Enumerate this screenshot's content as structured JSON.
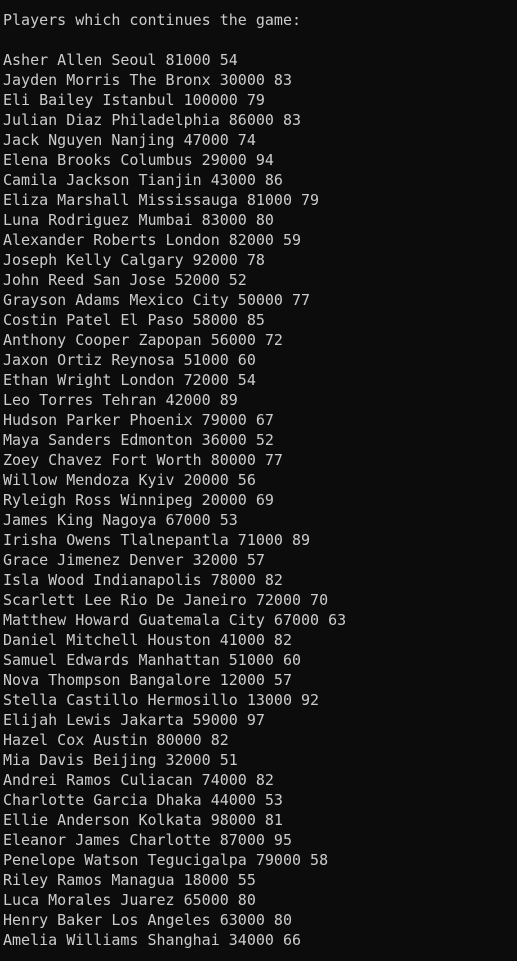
{
  "console": {
    "header": "Players which continues the game:",
    "players": [
      "Asher Allen Seoul 81000 54",
      "Jayden Morris The Bronx 30000 83",
      "Eli Bailey Istanbul 100000 79",
      "Julian Diaz Philadelphia 86000 83",
      "Jack Nguyen Nanjing 47000 74",
      "Elena Brooks Columbus 29000 94",
      "Camila Jackson Tianjin 43000 86",
      "Eliza Marshall Mississauga 81000 79",
      "Luna Rodriguez Mumbai 83000 80",
      "Alexander Roberts London 82000 59",
      "Joseph Kelly Calgary 92000 78",
      "John Reed San Jose 52000 52",
      "Grayson Adams Mexico City 50000 77",
      "Costin Patel El Paso 58000 85",
      "Anthony Cooper Zapopan 56000 72",
      "Jaxon Ortiz Reynosa 51000 60",
      "Ethan Wright London 72000 54",
      "Leo Torres Tehran 42000 89",
      "Hudson Parker Phoenix 79000 67",
      "Maya Sanders Edmonton 36000 52",
      "Zoey Chavez Fort Worth 80000 77",
      "Willow Mendoza Kyiv 20000 56",
      "Ryleigh Ross Winnipeg 20000 69",
      "James King Nagoya 67000 53",
      "Irisha Owens Tlalnepantla 71000 89",
      "Grace Jimenez Denver 32000 57",
      "Isla Wood Indianapolis 78000 82",
      "Scarlett Lee Rio De Janeiro 72000 70",
      "Matthew Howard Guatemala City 67000 63",
      "Daniel Mitchell Houston 41000 82",
      "Samuel Edwards Manhattan 51000 60",
      "Nova Thompson Bangalore 12000 57",
      "Stella Castillo Hermosillo 13000 92",
      "Elijah Lewis Jakarta 59000 97",
      "Hazel Cox Austin 80000 82",
      "Mia Davis Beijing 32000 51",
      "Andrei Ramos Culiacan 74000 82",
      "Charlotte Garcia Dhaka 44000 53",
      "Ellie Anderson Kolkata 98000 81",
      "Eleanor James Charlotte 87000 95",
      "Penelope Watson Tegucigalpa 79000 58",
      "Riley Ramos Managua 18000 55",
      "Luca Morales Juarez 65000 80",
      "Henry Baker Los Angeles 63000 80",
      "Amelia Williams Shanghai 34000 66"
    ]
  },
  "colors": {
    "background": "#0c0c0c",
    "text": "#cccccc"
  }
}
